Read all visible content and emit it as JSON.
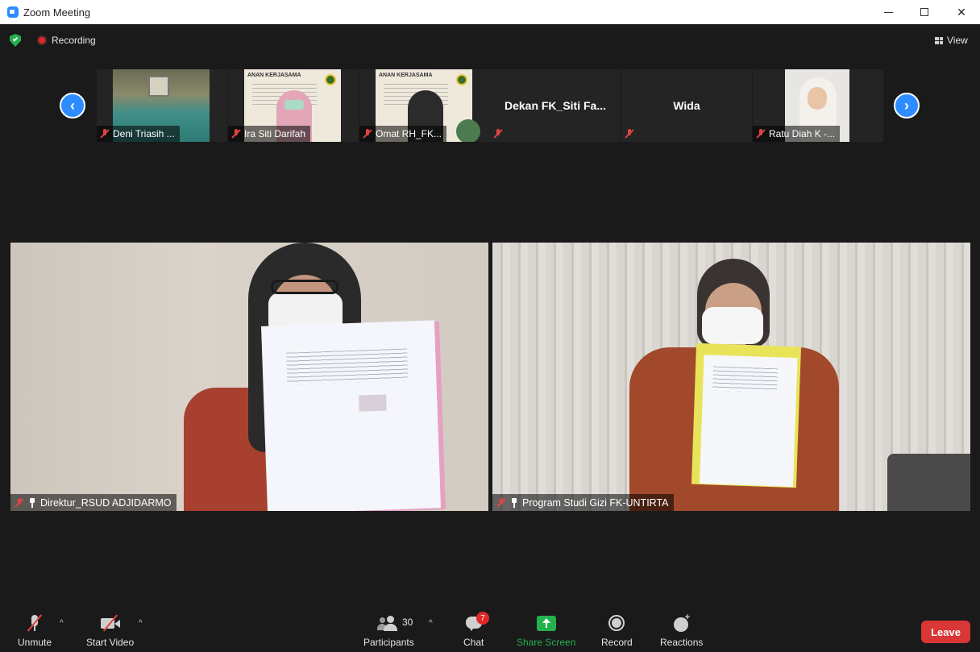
{
  "window": {
    "title": "Zoom Meeting",
    "accent_color": "#2d8cff"
  },
  "topbar": {
    "recording_label": "Recording",
    "view_label": "View"
  },
  "thumbnails": [
    {
      "name": "Deni Triasih ...",
      "mic_muted": true,
      "has_video": true
    },
    {
      "name": "Ira Siti Darifah",
      "mic_muted": true,
      "has_video": true,
      "banner_text": "ANAN KERJASAMA"
    },
    {
      "name": "Omat RH_FK...",
      "mic_muted": true,
      "has_video": true,
      "banner_text": "ANAN KERJASAMA"
    },
    {
      "name": "Dekan  FK_Siti  Fa...",
      "mic_muted": true,
      "has_video": false
    },
    {
      "name": "Wida",
      "mic_muted": true,
      "has_video": false
    },
    {
      "name": "Ratu Diah K -...",
      "mic_muted": true,
      "has_video": true
    }
  ],
  "main_videos": [
    {
      "name": "Direktur_RSUD ADJIDARMO",
      "mic_muted": true,
      "pinned": true
    },
    {
      "name": "Program Studi Gizi FK-UNTIRTA",
      "mic_muted": true,
      "pinned": true
    }
  ],
  "toolbar": {
    "unmute_label": "Unmute",
    "start_video_label": "Start Video",
    "participants_label": "Participants",
    "participants_count": "30",
    "chat_label": "Chat",
    "chat_badge": "7",
    "share_screen_label": "Share Screen",
    "record_label": "Record",
    "reactions_label": "Reactions",
    "leave_label": "Leave",
    "share_color": "#23b14d",
    "leave_color": "#d93636"
  }
}
